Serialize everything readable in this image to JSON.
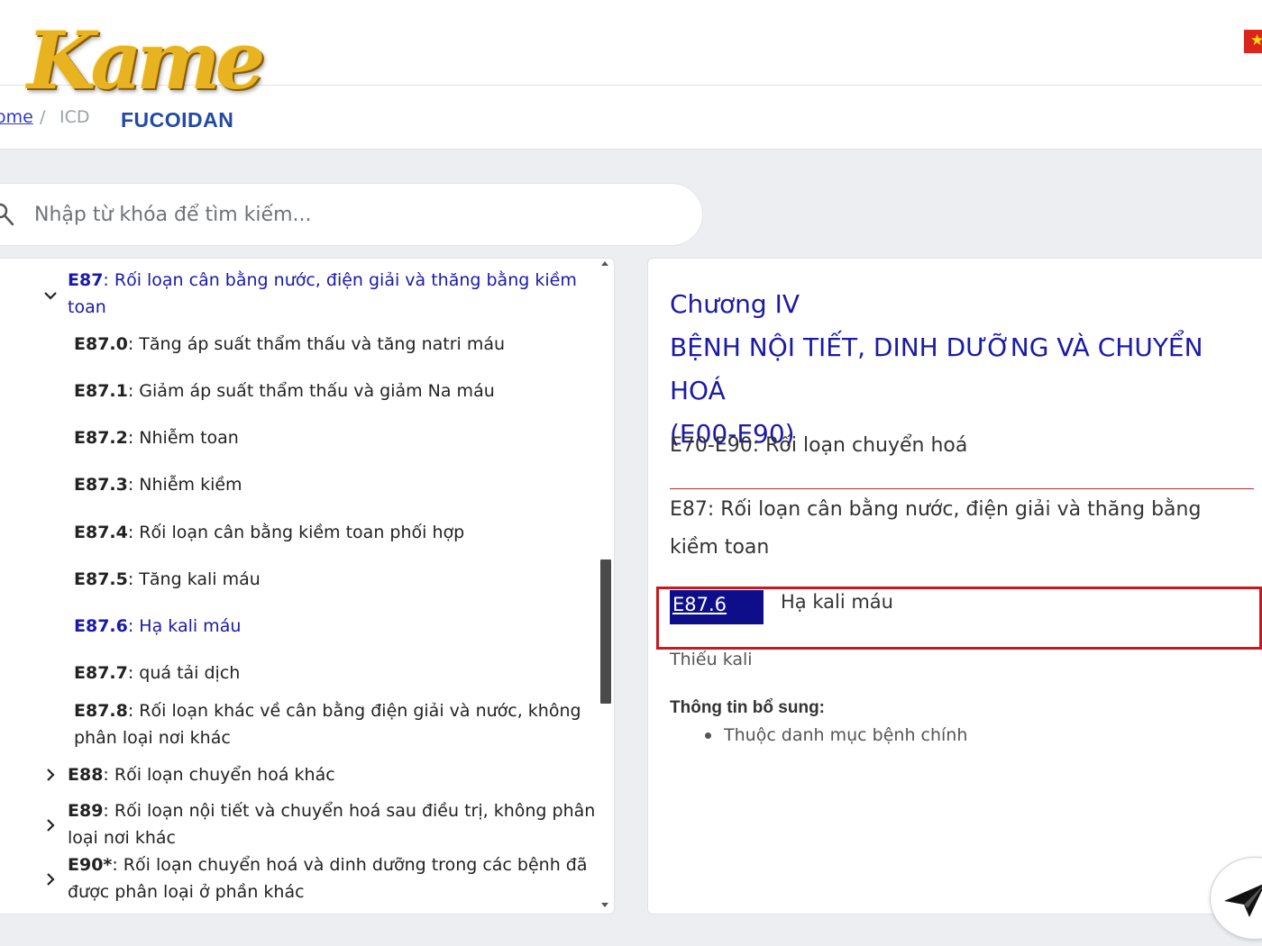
{
  "header": {
    "logo_main": "Kame",
    "logo_sub": "FUCOIDAN",
    "flag_icon": "vietnam-flag-icon"
  },
  "breadcrumb": {
    "home": "ome",
    "separator": "/",
    "current": "ICD"
  },
  "search": {
    "placeholder": "Nhập từ khóa để tìm kiếm..."
  },
  "tree": {
    "parent": {
      "code": "E87",
      "label": ": Rối loạn cân bằng nước, điện giải và thăng bằng kiềm",
      "label_cont": "toan"
    },
    "children": [
      {
        "code": "E87.0",
        "label": ": Tăng áp suất thẩm thấu và tăng natri máu"
      },
      {
        "code": "E87.1",
        "label": ": Giảm áp suất thẩm thấu và giảm Na máu"
      },
      {
        "code": "E87.2",
        "label": ": Nhiễm toan"
      },
      {
        "code": "E87.3",
        "label": ": Nhiễm kiềm"
      },
      {
        "code": "E87.4",
        "label": ": Rối loạn cân bằng kiềm toan phối hợp"
      },
      {
        "code": "E87.5",
        "label": ": Tăng kali máu"
      },
      {
        "code": "E87.6",
        "label": ": Hạ kali máu"
      },
      {
        "code": "E87.7",
        "label": ": quá tải dịch"
      },
      {
        "code": "E87.8",
        "label": ": Rối loạn khác về cân bằng điện giải và nước, không",
        "label_cont": "phân loại nơi khác"
      }
    ],
    "siblings": [
      {
        "code": "E88",
        "label": ": Rối loạn chuyển hoá khác"
      },
      {
        "code": "E89",
        "label": ": Rối loạn nội tiết và chuyển hoá sau điều trị, không phân",
        "label_cont": "loại nơi khác"
      },
      {
        "code": "E90*",
        "label": ": Rối loạn chuyển hoá và dinh dưỡng trong các bệnh đã",
        "label_cont": "được phân loại ở phần khác"
      }
    ]
  },
  "detail": {
    "chapter": "Chương IV",
    "chapter_title": "BỆNH NỘI TIẾT, DINH DƯỠNG VÀ CHUYỂN HOÁ",
    "chapter_range": "(E00-E90)",
    "group": "E70-E90: Rối loạn chuyển hoá",
    "category": "E87: Rối loạn cân bằng nước, điện giải và thăng bằng kiềm toan",
    "code": "E87.6",
    "code_title": "Hạ kali máu",
    "synonym": "Thiếu kali",
    "extra_title": "Thông tin bổ sung:",
    "extra_items": [
      "Thuộc danh mục bệnh chính"
    ]
  },
  "colors": {
    "accent": "#1a1aa8",
    "highlight_border": "#c8191f",
    "badge_bg": "#0e0e8a"
  }
}
